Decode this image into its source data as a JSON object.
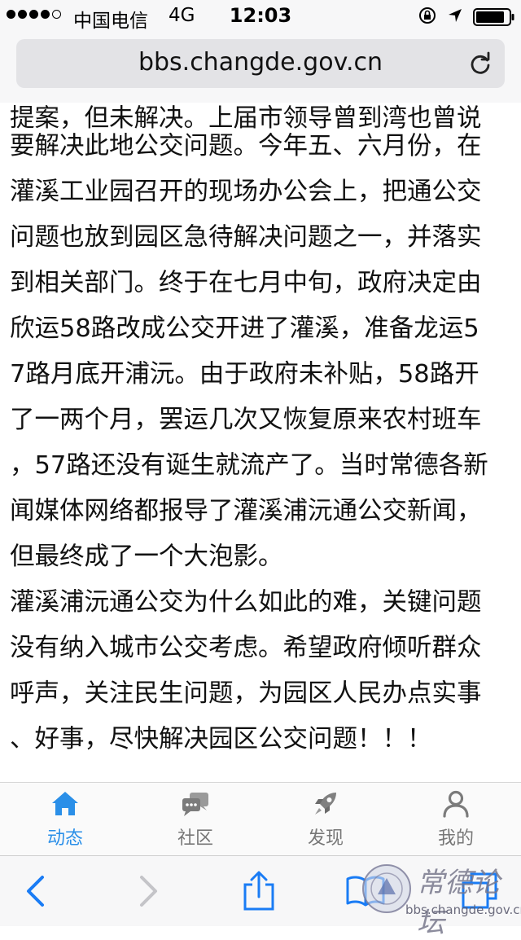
{
  "status_bar": {
    "carrier": "中国电信",
    "network": "4G",
    "time": "12:03"
  },
  "browser": {
    "url": "bbs.changde.gov.cn"
  },
  "article": {
    "lines": [
      "提案，但未解决。上届市领导曾到湾也曾说",
      "要解决此地公交问题。今年五、六月份，在",
      "灌溪工业园召开的现场办公会上，把通公交",
      "问题也放到园区急待解决问题之一，并落实",
      "到相关部门。终于在七月中旬，政府决定由",
      "欣运58路改成公交开进了灌溪，准备龙运5",
      "7路月底开浦沅。由于政府未补贴，58路开",
      "了一两个月，罢运几次又恢复原来农村班车",
      "，57路还没有诞生就流产了。当时常德各新",
      "闻媒体网络都报导了灌溪浦沅通公交新闻，",
      "但最终成了一个大泡影。",
      "灌溪浦沅通公交为什么如此的难，关键问题",
      "没有纳入城市公交考虑。希望政府倾听群众",
      "呼声，关注民生问题，为园区人民办点实事",
      "、好事，尽快解决园区公交问题！！！"
    ]
  },
  "forum_tabs": [
    {
      "label": "动态",
      "icon": "home-icon",
      "active": true
    },
    {
      "label": "社区",
      "icon": "chat-icon",
      "active": false
    },
    {
      "label": "发现",
      "icon": "rocket-icon",
      "active": false
    },
    {
      "label": "我的",
      "icon": "user-icon",
      "active": false
    }
  ],
  "watermark": {
    "title": "常德论坛",
    "url": "bbs.changde.gov.cn"
  },
  "colors": {
    "accent": "#2a8fe8",
    "tab_inactive": "#777777",
    "toolbar_blue": "#1a7cf5",
    "disabled": "#c4c4c8"
  }
}
